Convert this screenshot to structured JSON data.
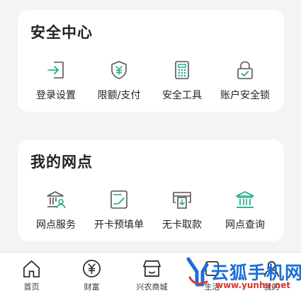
{
  "security": {
    "title": "安全中心",
    "items": [
      {
        "label": "登录设置",
        "icon": "login-icon"
      },
      {
        "label": "限额/支付",
        "icon": "yuan-shield-icon"
      },
      {
        "label": "安全工具",
        "icon": "keypad-icon"
      },
      {
        "label": "账户安全锁",
        "icon": "lock-icon"
      }
    ]
  },
  "branch": {
    "title": "我的网点",
    "items": [
      {
        "label": "网点服务",
        "icon": "bank-person-icon"
      },
      {
        "label": "开卡预填单",
        "icon": "form-edit-icon"
      },
      {
        "label": "无卡取款",
        "icon": "atm-withdraw-icon"
      },
      {
        "label": "网点查询",
        "icon": "bank-building-icon"
      }
    ]
  },
  "tabbar": {
    "items": [
      {
        "label": "首页",
        "icon": "home-icon"
      },
      {
        "label": "财富",
        "icon": "yuan-circle-icon"
      },
      {
        "label": "兴农商城",
        "icon": "shop-icon"
      },
      {
        "label": "生活",
        "icon": "life-icon"
      },
      {
        "label": "我的",
        "icon": "person-icon"
      }
    ]
  },
  "watermark": {
    "text": "云狐手机网",
    "url": "www.yunhu.net"
  },
  "colors": {
    "icon_gray": "#555555",
    "accent_green": "#12a88a",
    "watermark_blue": "#1b6fd6",
    "watermark_red": "#d9362b"
  }
}
